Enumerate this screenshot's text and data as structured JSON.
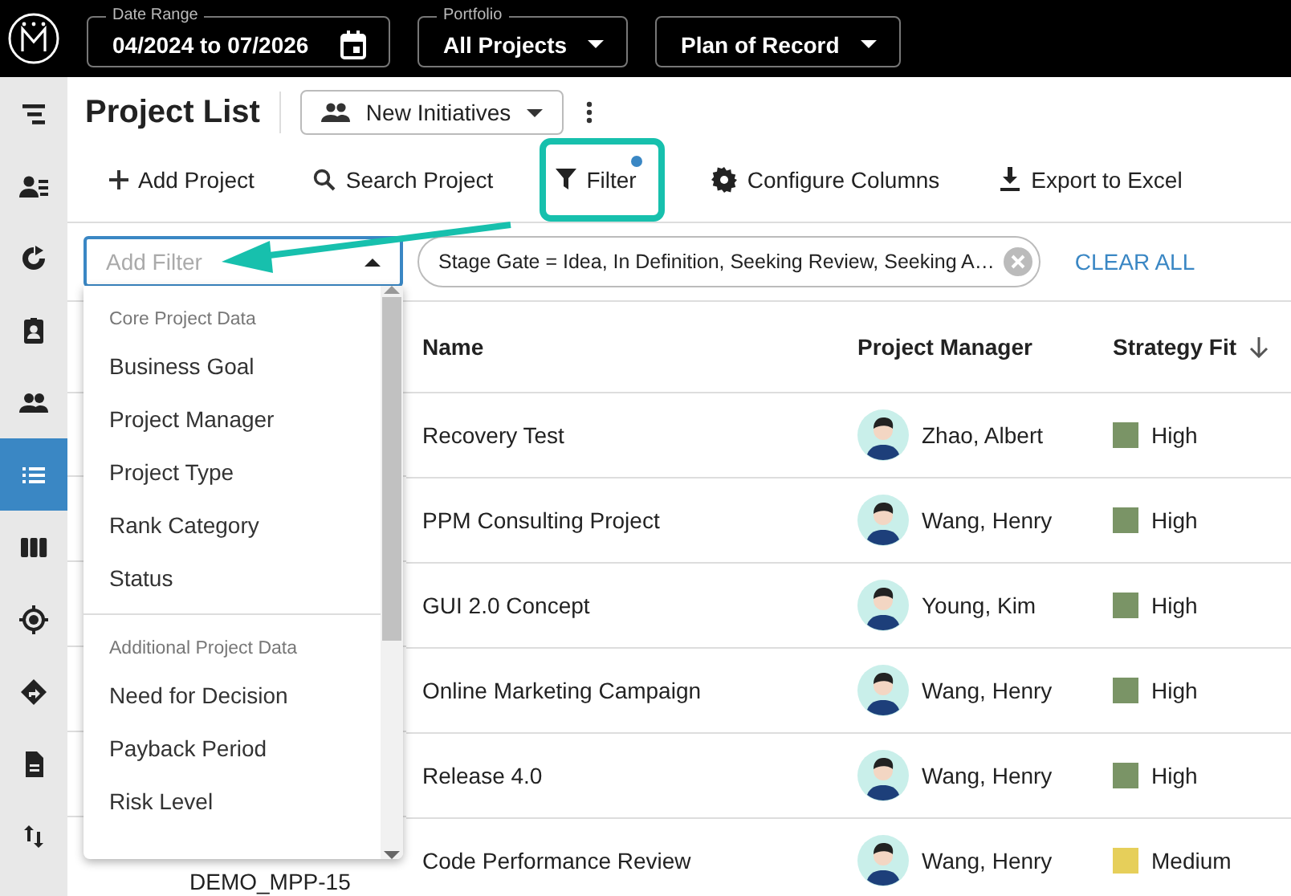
{
  "header": {
    "date_range": {
      "label": "Date Range",
      "value": "04/2024 to 07/2026"
    },
    "portfolio": {
      "label": "Portfolio",
      "value": "All Projects"
    },
    "scenario": {
      "value": "Plan of Record"
    }
  },
  "sidebar": {
    "items": [
      {
        "kind": "outline",
        "selected": false
      },
      {
        "kind": "contacts",
        "selected": false
      },
      {
        "kind": "refresh",
        "selected": false
      },
      {
        "kind": "badge",
        "selected": false
      },
      {
        "kind": "people",
        "selected": false
      },
      {
        "kind": "list",
        "selected": true
      },
      {
        "kind": "columns",
        "selected": false
      },
      {
        "kind": "target",
        "selected": false
      },
      {
        "kind": "directions",
        "selected": false
      },
      {
        "kind": "document",
        "selected": false
      },
      {
        "kind": "sort",
        "selected": false
      }
    ]
  },
  "page": {
    "title": "Project List",
    "view": "New Initiatives"
  },
  "toolbar": [
    {
      "kind": "add",
      "label": "Add Project",
      "highlighted": false,
      "badge": false
    },
    {
      "kind": "search",
      "label": "Search Project",
      "highlighted": false,
      "badge": false
    },
    {
      "kind": "filter",
      "label": "Filter",
      "highlighted": true,
      "badge": true
    },
    {
      "kind": "settings",
      "label": "Configure Columns",
      "highlighted": false,
      "badge": false
    },
    {
      "kind": "export",
      "label": "Export to Excel",
      "highlighted": false,
      "badge": false
    }
  ],
  "filter_bar": {
    "placeholder": "Add Filter",
    "expanded": true,
    "chip": "Stage Gate = Idea, In Definition, Seeking Review, Seeking A…",
    "clear": "CLEAR ALL"
  },
  "dropdown": {
    "groups": [
      {
        "heading": "Core Project Data",
        "items": [
          "Business Goal",
          "Project Manager",
          "Project Type",
          "Rank Category",
          "Status"
        ]
      },
      {
        "heading": "Additional Project Data",
        "items": [
          "Need for Decision",
          "Payback Period",
          "Risk Level"
        ]
      }
    ]
  },
  "table": {
    "columns": [
      {
        "label": "Name",
        "sorted": false
      },
      {
        "label": "Project Manager",
        "sorted": false
      },
      {
        "label": "Strategy Fit",
        "sorted": true
      }
    ],
    "rows": [
      {
        "name": "Recovery Test",
        "manager": "Zhao, Albert",
        "fit": "High",
        "color": "#7a9466"
      },
      {
        "name": "PPM Consulting Project",
        "manager": "Wang, Henry",
        "fit": "High",
        "color": "#7a9466"
      },
      {
        "name": "GUI 2.0 Concept",
        "manager": "Young, Kim",
        "fit": "High",
        "color": "#7a9466"
      },
      {
        "name": "Online Marketing Campaign",
        "manager": "Wang, Henry",
        "fit": "High",
        "color": "#7a9466"
      },
      {
        "name": "Release 4.0",
        "manager": "Wang, Henry",
        "fit": "High",
        "color": "#7a9466"
      },
      {
        "id": "DEMO_MPP-15",
        "name": "Code Performance Review",
        "manager": "Wang, Henry",
        "fit": "Medium",
        "color": "#e6cf5a"
      }
    ]
  }
}
